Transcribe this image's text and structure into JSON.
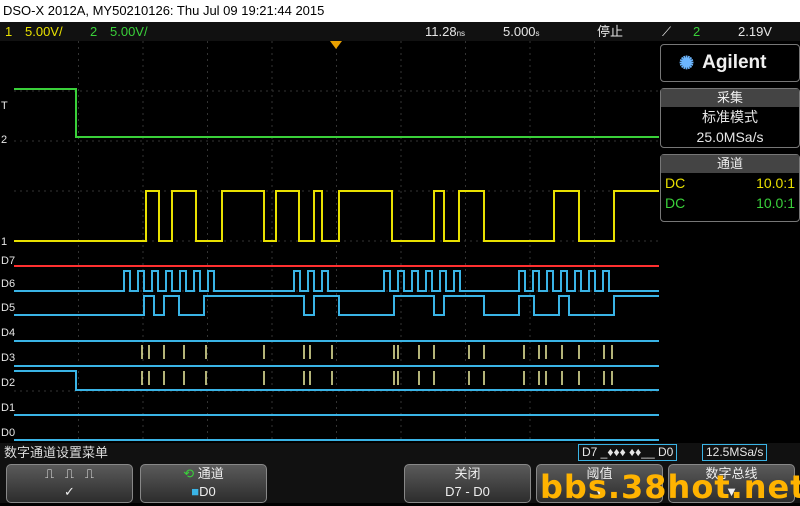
{
  "title": "DSO-X 2012A, MY50210126: Thu Jul 09 19:21:44 2015",
  "status": {
    "ch1_num": "1",
    "ch1_scale": "5.00V/",
    "ch2_num": "2",
    "ch2_scale": "5.00V/",
    "delay": "11.28",
    "delay_unit": "ns",
    "timebase": "5.000",
    "timebase_unit": "s",
    "run_state": "停止",
    "trigger_source": "2",
    "trigger_level": "2.19V"
  },
  "brand": "Agilent",
  "acquisition": {
    "title": "采集",
    "mode": "标准模式",
    "rate": "25.0MSa/s"
  },
  "channels_panel": {
    "title": "通道",
    "rows": [
      {
        "coupling": "DC",
        "probe": "10.0:1",
        "color": "#e8e000"
      },
      {
        "coupling": "DC",
        "probe": "10.0:1",
        "color": "#3ad03a"
      }
    ]
  },
  "menu_title": "数字通道设置菜单",
  "digital_indicator": "D7 _♦♦♦ ♦♦__ D0",
  "digital_rate": "12.5MSa/s",
  "channel_labels": [
    "D7",
    "D6",
    "D5",
    "D4",
    "D3",
    "D2",
    "D1",
    "D0"
  ],
  "softkeys": {
    "channel_label": "通道",
    "channel_value": "D0",
    "off_label": "关闭",
    "off_value": "D7 - D0",
    "threshold_label": "阈值",
    "bus_label": "数字总线"
  },
  "watermark": "bbs.38hot.net",
  "colors": {
    "ch1": "#e8e000",
    "ch2": "#3ad03a",
    "digital": "#3ab4e6",
    "d7": "#ff3030"
  }
}
